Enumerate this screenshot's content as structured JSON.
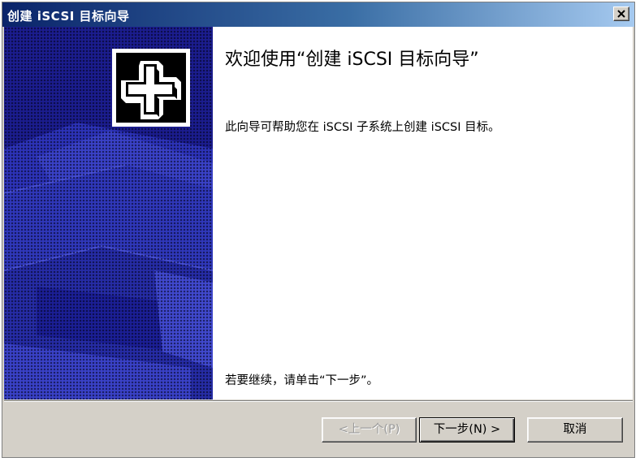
{
  "window": {
    "title": "创建 iSCSI 目标向导",
    "close_icon": "close-icon"
  },
  "banner": {
    "logo_icon": "wizard-cross-logo-icon",
    "background_color": "#1b1d8f"
  },
  "main": {
    "heading": "欢迎使用“创建 iSCSI 目标向导”",
    "description": "此向导可帮助您在 iSCSI 子系统上创建 iSCSI 目标。",
    "continue_hint": "若要继续，请单击“下一步”。"
  },
  "buttons": {
    "back_label": "<上一个(P)",
    "next_label": "下一步(N) >",
    "cancel_label": "取消"
  },
  "colors": {
    "titlebar_start": "#0a246a",
    "titlebar_end": "#a6caf0",
    "dialog_face": "#d4d0c8"
  }
}
